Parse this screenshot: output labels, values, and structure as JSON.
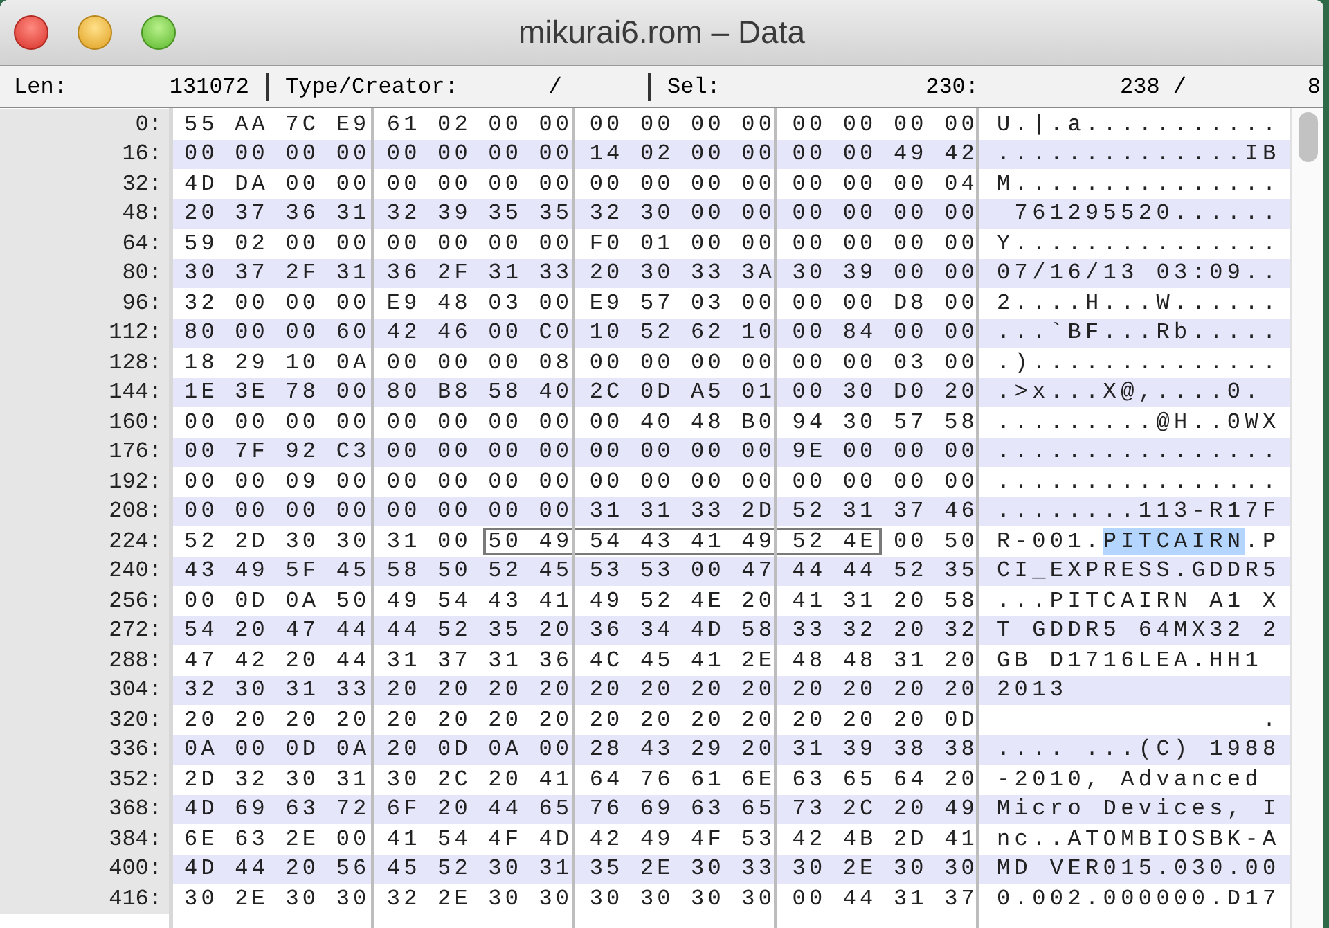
{
  "window": {
    "title": "mikurai6.rom – Data"
  },
  "info_bar": {
    "len_label": "Len:",
    "len": "131072",
    "type_creator_label": "Type/Creator:",
    "type_creator": "/",
    "sel_label": "Sel:",
    "sel_start": "230:",
    "sel_end": "238 /",
    "sel_length": "8"
  },
  "rows": [
    {
      "offset": "0:",
      "hex": [
        {
          "bytes": "55 AA 7C E9 61 02 00 00 00 00 00 00 00 00 00 00",
          "selected": false
        }
      ],
      "ascii": [
        {
          "text": "U.|.a...........",
          "selected": false
        }
      ]
    },
    {
      "offset": "16:",
      "hex": [
        {
          "bytes": "00 00 00 00 00 00 00 00 14 02 00 00 00 00 49 42",
          "selected": false
        }
      ],
      "ascii": [
        {
          "text": "..............IB",
          "selected": false
        }
      ]
    },
    {
      "offset": "32:",
      "hex": [
        {
          "bytes": "4D DA 00 00 00 00 00 00 00 00 00 00 00 00 00 04",
          "selected": false
        }
      ],
      "ascii": [
        {
          "text": "M...............",
          "selected": false
        }
      ]
    },
    {
      "offset": "48:",
      "hex": [
        {
          "bytes": "20 37 36 31 32 39 35 35 32 30 00 00 00 00 00 00",
          "selected": false
        }
      ],
      "ascii": [
        {
          "text": " 761295520......",
          "selected": false
        }
      ]
    },
    {
      "offset": "64:",
      "hex": [
        {
          "bytes": "59 02 00 00 00 00 00 00 F0 01 00 00 00 00 00 00",
          "selected": false
        }
      ],
      "ascii": [
        {
          "text": "Y...............",
          "selected": false
        }
      ]
    },
    {
      "offset": "80:",
      "hex": [
        {
          "bytes": "30 37 2F 31 36 2F 31 33 20 30 33 3A 30 39 00 00",
          "selected": false
        }
      ],
      "ascii": [
        {
          "text": "07/16/13 03:09..",
          "selected": false
        }
      ]
    },
    {
      "offset": "96:",
      "hex": [
        {
          "bytes": "32 00 00 00 E9 48 03 00 E9 57 03 00 00 00 D8 00",
          "selected": false
        }
      ],
      "ascii": [
        {
          "text": "2....H...W......",
          "selected": false
        }
      ]
    },
    {
      "offset": "112:",
      "hex": [
        {
          "bytes": "80 00 00 60 42 46 00 C0 10 52 62 10 00 84 00 00",
          "selected": false
        }
      ],
      "ascii": [
        {
          "text": "...`BF...Rb.....",
          "selected": false
        }
      ]
    },
    {
      "offset": "128:",
      "hex": [
        {
          "bytes": "18 29 10 0A 00 00 00 08 00 00 00 00 00 00 03 00",
          "selected": false
        }
      ],
      "ascii": [
        {
          "text": ".)..............",
          "selected": false
        }
      ]
    },
    {
      "offset": "144:",
      "hex": [
        {
          "bytes": "1E 3E 78 00 80 B8 58 40 2C 0D A5 01 00 30 D0 20",
          "selected": false
        }
      ],
      "ascii": [
        {
          "text": ".>x...X@,....0. ",
          "selected": false
        }
      ]
    },
    {
      "offset": "160:",
      "hex": [
        {
          "bytes": "00 00 00 00 00 00 00 00 00 40 48 B0 94 30 57 58",
          "selected": false
        }
      ],
      "ascii": [
        {
          "text": ".........@H..0WX",
          "selected": false
        }
      ]
    },
    {
      "offset": "176:",
      "hex": [
        {
          "bytes": "00 7F 92 C3 00 00 00 00 00 00 00 00 9E 00 00 00",
          "selected": false
        }
      ],
      "ascii": [
        {
          "text": "................",
          "selected": false
        }
      ]
    },
    {
      "offset": "192:",
      "hex": [
        {
          "bytes": "00 00 09 00 00 00 00 00 00 00 00 00 00 00 00 00",
          "selected": false
        }
      ],
      "ascii": [
        {
          "text": "................",
          "selected": false
        }
      ]
    },
    {
      "offset": "208:",
      "hex": [
        {
          "bytes": "00 00 00 00 00 00 00 00 31 31 33 2D 52 31 37 46",
          "selected": false
        }
      ],
      "ascii": [
        {
          "text": "........113-R17F",
          "selected": false
        }
      ]
    },
    {
      "offset": "224:",
      "hex": [
        {
          "bytes": "52 2D 30 30 31 00",
          "selected": false
        },
        {
          "bytes": "50 49 54 43 41 49 52 4E",
          "selected": true
        },
        {
          "bytes": "00 50",
          "selected": false
        }
      ],
      "ascii": [
        {
          "text": "R-001.",
          "selected": false
        },
        {
          "text": "PITCAIRN",
          "selected": true
        },
        {
          "text": ".P",
          "selected": false
        }
      ]
    },
    {
      "offset": "240:",
      "hex": [
        {
          "bytes": "43 49 5F 45 58 50 52 45 53 53 00 47 44 44 52 35",
          "selected": false
        }
      ],
      "ascii": [
        {
          "text": "CI_EXPRESS.GDDR5",
          "selected": false
        }
      ]
    },
    {
      "offset": "256:",
      "hex": [
        {
          "bytes": "00 0D 0A 50 49 54 43 41 49 52 4E 20 41 31 20 58",
          "selected": false
        }
      ],
      "ascii": [
        {
          "text": "...PITCAIRN A1 X",
          "selected": false
        }
      ]
    },
    {
      "offset": "272:",
      "hex": [
        {
          "bytes": "54 20 47 44 44 52 35 20 36 34 4D 58 33 32 20 32",
          "selected": false
        }
      ],
      "ascii": [
        {
          "text": "T GDDR5 64MX32 2",
          "selected": false
        }
      ]
    },
    {
      "offset": "288:",
      "hex": [
        {
          "bytes": "47 42 20 44 31 37 31 36 4C 45 41 2E 48 48 31 20",
          "selected": false
        }
      ],
      "ascii": [
        {
          "text": "GB D1716LEA.HH1 ",
          "selected": false
        }
      ]
    },
    {
      "offset": "304:",
      "hex": [
        {
          "bytes": "32 30 31 33 20 20 20 20 20 20 20 20 20 20 20 20",
          "selected": false
        }
      ],
      "ascii": [
        {
          "text": "2013            ",
          "selected": false
        }
      ]
    },
    {
      "offset": "320:",
      "hex": [
        {
          "bytes": "20 20 20 20 20 20 20 20 20 20 20 20 20 20 20 0D",
          "selected": false
        }
      ],
      "ascii": [
        {
          "text": "               .",
          "selected": false
        }
      ]
    },
    {
      "offset": "336:",
      "hex": [
        {
          "bytes": "0A 00 0D 0A 20 0D 0A 00 28 43 29 20 31 39 38 38",
          "selected": false
        }
      ],
      "ascii": [
        {
          "text": ".... ...(C) 1988",
          "selected": false
        }
      ]
    },
    {
      "offset": "352:",
      "hex": [
        {
          "bytes": "2D 32 30 31 30 2C 20 41 64 76 61 6E 63 65 64 20",
          "selected": false
        }
      ],
      "ascii": [
        {
          "text": "-2010, Advanced ",
          "selected": false
        }
      ]
    },
    {
      "offset": "368:",
      "hex": [
        {
          "bytes": "4D 69 63 72 6F 20 44 65 76 69 63 65 73 2C 20 49",
          "selected": false
        }
      ],
      "ascii": [
        {
          "text": "Micro Devices, I",
          "selected": false
        }
      ]
    },
    {
      "offset": "384:",
      "hex": [
        {
          "bytes": "6E 63 2E 00 41 54 4F 4D 42 49 4F 53 42 4B 2D 41",
          "selected": false
        }
      ],
      "ascii": [
        {
          "text": "nc..ATOMBIOSBK-A",
          "selected": false
        }
      ]
    },
    {
      "offset": "400:",
      "hex": [
        {
          "bytes": "4D 44 20 56 45 52 30 31 35 2E 30 33 30 2E 30 30",
          "selected": false
        }
      ],
      "ascii": [
        {
          "text": "MD VER015.030.00",
          "selected": false
        }
      ]
    },
    {
      "offset": "416:",
      "hex": [
        {
          "bytes": "30 2E 30 30 32 2E 30 30 30 30 30 30 00 44 31 37",
          "selected": false
        }
      ],
      "ascii": [
        {
          "text": "0.002.000000.D17",
          "selected": false
        }
      ]
    }
  ]
}
